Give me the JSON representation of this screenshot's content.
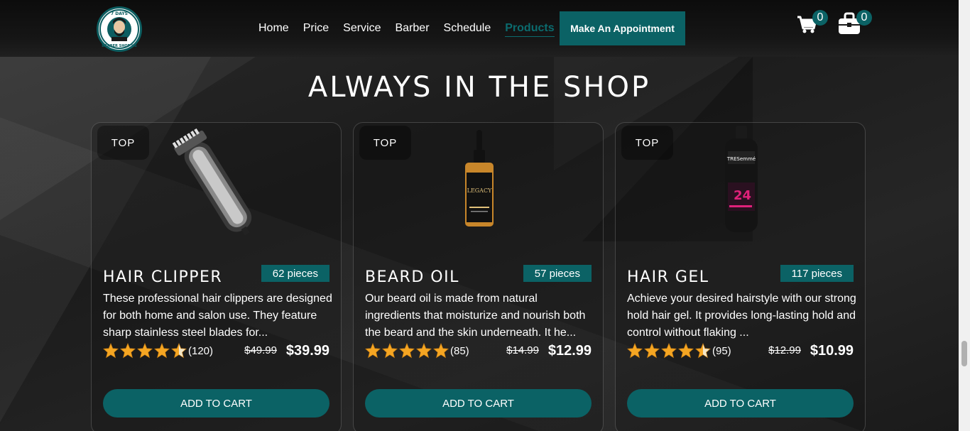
{
  "header": {
    "logo_alt": "7 Days Barber Shop US",
    "menu": [
      {
        "label": "Home",
        "active": false
      },
      {
        "label": "Price",
        "active": false
      },
      {
        "label": "Service",
        "active": false
      },
      {
        "label": "Barber",
        "active": false
      },
      {
        "label": "Schedule",
        "active": false
      },
      {
        "label": "Products",
        "active": true
      }
    ],
    "appointment_label": "Make An Appointment",
    "cart_count": "0",
    "bag_count": "0"
  },
  "section": {
    "title": "ALWAYS IN THE SHOP"
  },
  "products": [
    {
      "tag": "TOP",
      "image_icon": "hair-clipper-icon",
      "name": "HAIR CLIPPER",
      "stock": "62 pieces",
      "description": "These professional hair clippers are designed for both home and salon use. They feature sharp stainless steel blades for...",
      "rating": 4.5,
      "reviews": "(120)",
      "old_price": "$49.99",
      "price": "$39.99",
      "button": "ADD TO CART"
    },
    {
      "tag": "TOP",
      "image_icon": "beard-oil-bottle-icon",
      "name": "BEARD OIL",
      "stock": "57 pieces",
      "description": "Our beard oil is made from natural ingredients that moisturize and nourish both the beard and the skin underneath. It he...",
      "rating": 5,
      "reviews": "(85)",
      "old_price": "$14.99",
      "price": "$12.99",
      "button": "ADD TO CART"
    },
    {
      "tag": "TOP",
      "image_icon": "hair-gel-bottle-icon",
      "name": "HAIR GEL",
      "stock": "117 pieces",
      "description": "Achieve your desired hairstyle with our strong hold hair gel. It provides long-lasting hold and control without flaking ...",
      "rating": 4.5,
      "reviews": "(95)",
      "old_price": "$12.99",
      "price": "$10.99",
      "button": "ADD TO CART"
    }
  ],
  "colors": {
    "accent": "#0b6265",
    "background": "#1f1f1f",
    "star": "#f5a623"
  }
}
